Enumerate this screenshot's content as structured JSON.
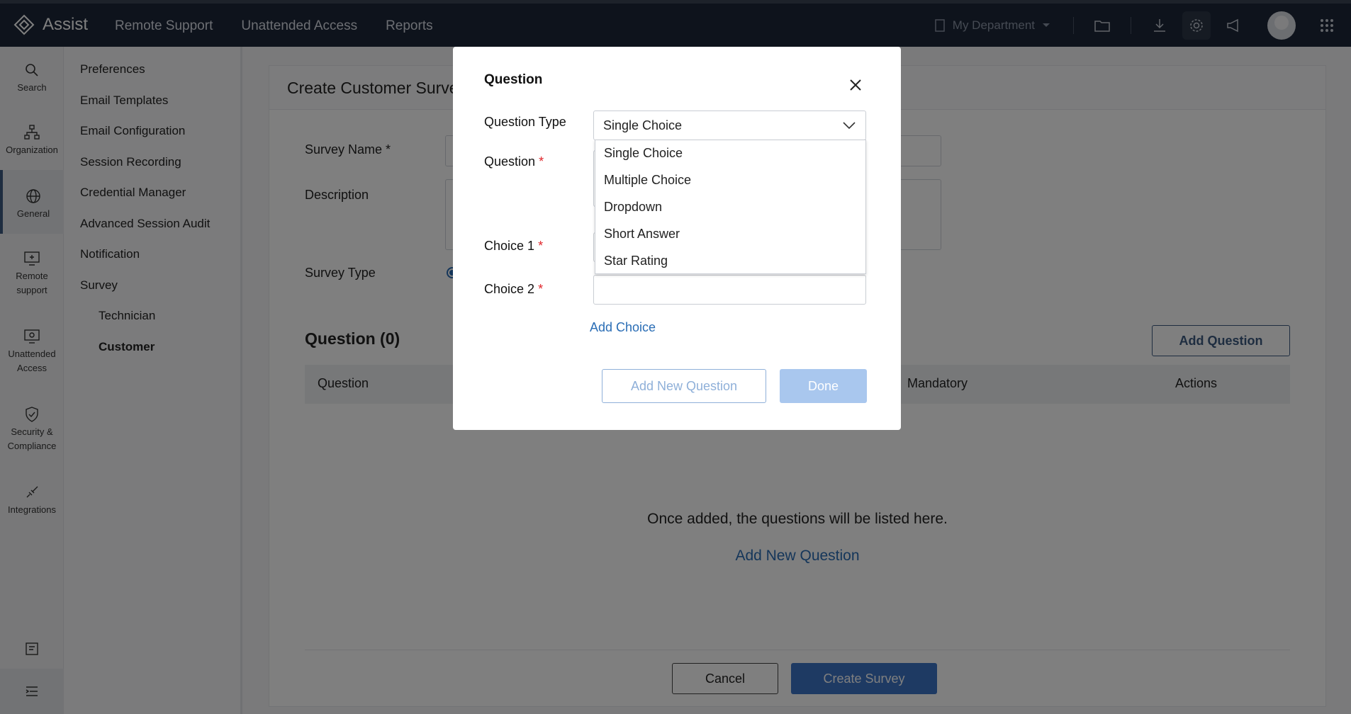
{
  "app": {
    "name": "Assist"
  },
  "topnav": [
    "Remote Support",
    "Unattended Access",
    "Reports"
  ],
  "topbar": {
    "department": "My Department"
  },
  "rail": {
    "search": "Search",
    "organization": "Organization",
    "general": "General",
    "remote_support": "Remote support",
    "unattended_access": "Unattended Access",
    "security": "Security & Compliance",
    "integrations": "Integrations"
  },
  "sidenav": {
    "items": [
      "Preferences",
      "Email Templates",
      "Email Configuration",
      "Session Recording",
      "Credential Manager",
      "Advanced Session Audit",
      "Notification",
      "Survey"
    ],
    "survey_sub": [
      "Technician",
      "Customer"
    ]
  },
  "main": {
    "title": "Create Customer Survey",
    "survey_name_label": "Survey Name *",
    "description_label": "Description",
    "survey_type_label": "Survey Type",
    "questions_heading": "Question (0)",
    "add_question": "Add Question",
    "columns": {
      "question": "Question",
      "mandatory": "Mandatory",
      "actions": "Actions"
    },
    "empty_message": "Once added, the questions will be listed here.",
    "empty_link": "Add New Question",
    "cancel": "Cancel",
    "create": "Create Survey"
  },
  "modal": {
    "title": "Question",
    "question_type_label": "Question Type",
    "question_type_value": "Single Choice",
    "question_label": "Question",
    "choice1_label": "Choice 1",
    "choice2_label": "Choice 2",
    "required_mark": "*",
    "dropdown_options": [
      "Single Choice",
      "Multiple Choice",
      "Dropdown",
      "Short Answer",
      "Star Rating"
    ],
    "add_choice": "Add Choice",
    "add_new_question": "Add New Question",
    "done": "Done"
  },
  "colors": {
    "topbar": "#1d2738",
    "accent": "#3d5a80",
    "link": "#2a6db5",
    "required": "#e0262b"
  }
}
